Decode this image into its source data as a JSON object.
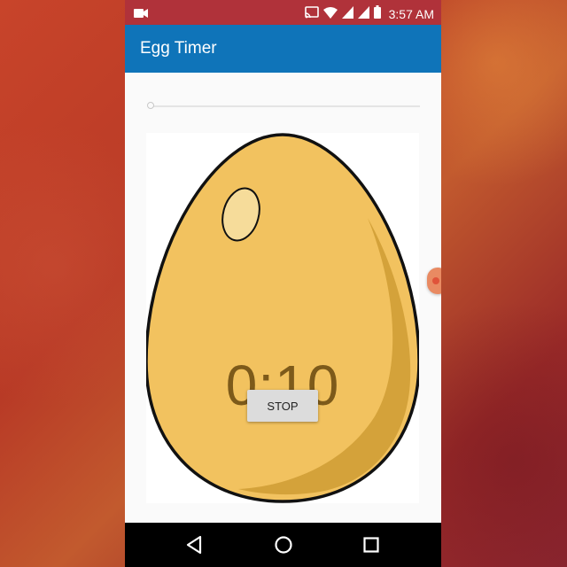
{
  "status_bar": {
    "time": "3:57 AM",
    "icons": [
      "video-camera-icon",
      "cast-icon",
      "wifi-icon",
      "cell-signal-icon",
      "cell-signal-icon",
      "battery-icon"
    ],
    "bar_color": "#b0323a"
  },
  "app_bar": {
    "title": "Egg Timer",
    "color": "#0f74b9"
  },
  "seekbar": {
    "value_fraction": 0.0
  },
  "egg": {
    "timer_text": "0:10",
    "stop_label": "STOP",
    "egg_color": "#f2c25f",
    "shadow_color": "#d4a23a",
    "highlight_color": "#f6dc9a"
  },
  "nav_bar": {
    "icons": [
      "back-icon",
      "home-icon",
      "recents-icon"
    ]
  }
}
